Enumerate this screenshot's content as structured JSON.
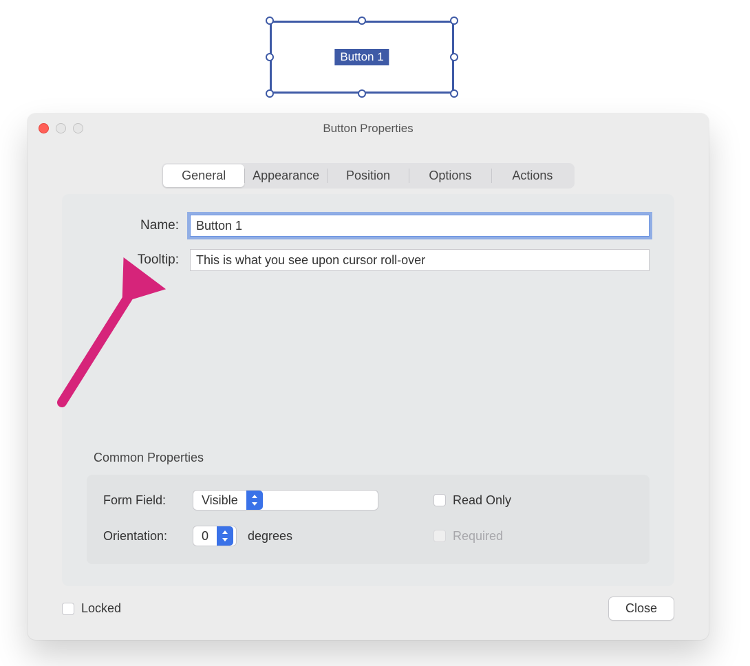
{
  "canvas": {
    "selected_button_label": "Button 1"
  },
  "window": {
    "title": "Button Properties",
    "tabs": [
      "General",
      "Appearance",
      "Position",
      "Options",
      "Actions"
    ],
    "active_tab": "General",
    "general": {
      "name_label": "Name:",
      "name_value": "Button 1",
      "tooltip_label": "Tooltip:",
      "tooltip_value": "This is what you see upon cursor roll-over"
    },
    "common": {
      "section_title": "Common Properties",
      "form_field_label": "Form Field:",
      "form_field_value": "Visible",
      "orientation_label": "Orientation:",
      "orientation_value": "0",
      "orientation_unit": "degrees",
      "read_only_label": "Read Only",
      "read_only_checked": false,
      "required_label": "Required",
      "required_checked": false,
      "required_disabled": true
    },
    "locked_label": "Locked",
    "locked_checked": false,
    "close_label": "Close"
  },
  "annotation": {
    "arrow_color": "#d6247a"
  }
}
